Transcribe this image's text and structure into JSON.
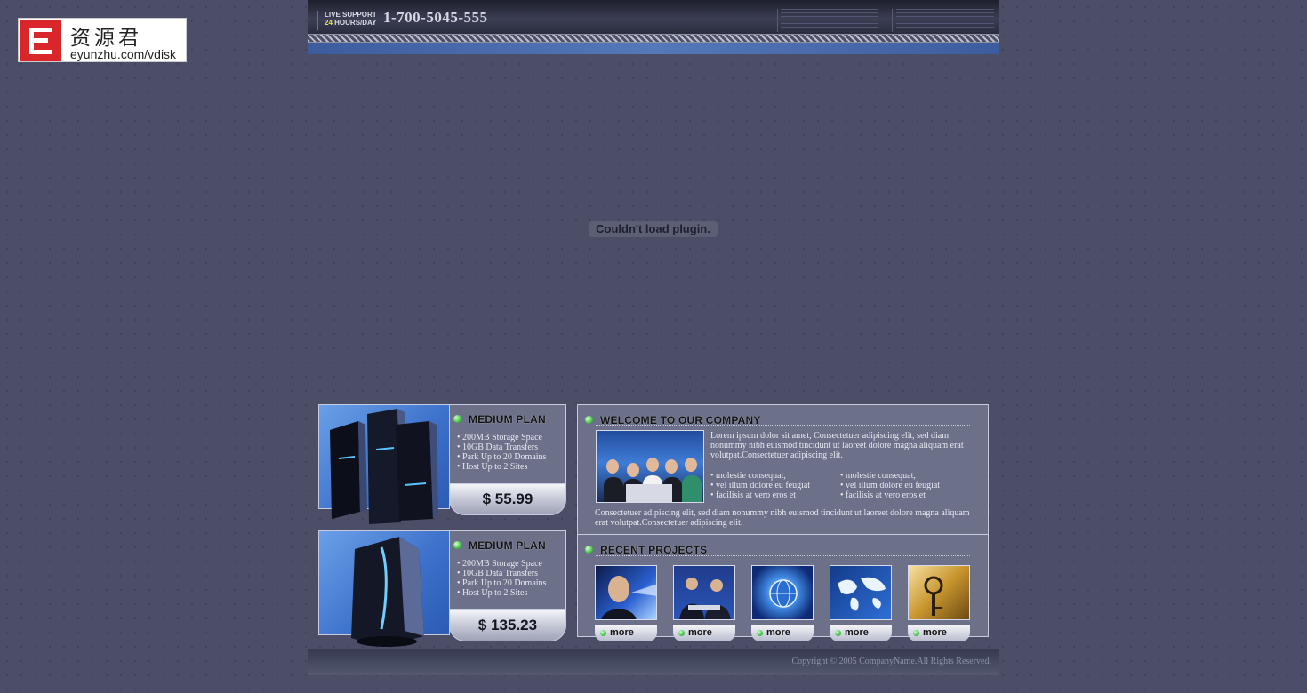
{
  "watermark": {
    "brand_cn": "资源君",
    "url": "eyunzhu.com/vdisk"
  },
  "header": {
    "live_support_line1": "LIVE SUPPORT",
    "live_support_24": "24",
    "live_support_line2": "HOURS/DAY",
    "phone": "1-700-5045-555"
  },
  "plugin": {
    "message": "Couldn't load plugin."
  },
  "plans": [
    {
      "title": "MEDIUM PLAN",
      "features": [
        "• 200MB Storage Space",
        "• 10GB Data Transfers",
        "• Park Up to 20 Domains",
        "• Host Up to 2 Sites"
      ],
      "price": "$ 55.99",
      "image": "server-rack"
    },
    {
      "title": "MEDIUM PLAN",
      "features": [
        "• 200MB Storage Space",
        "• 10GB Data Transfers",
        "• Park Up to 20 Domains",
        "• Host Up to 2 Sites"
      ],
      "price": "$ 135.23",
      "image": "server-tower"
    }
  ],
  "welcome": {
    "title": "WELCOME TO OUR COMPANY",
    "intro": "Lorem ipsum dolor sit amet, Consectetuer adipiscing elit, sed diam nonummy nibh euismod tincidunt ut laoreet dolore magna aliquam erat volutpat.Consectetuer adipiscing elit.",
    "bullets_left": [
      "• molestie consequat,",
      "• vel illum dolore eu feugiat",
      "• facilisis at vero eros et"
    ],
    "bullets_right": [
      "• molestie consequat,",
      "• vel illum dolore eu feugiat",
      "• facilisis at vero eros et"
    ],
    "outro": "Consectetuer adipiscing elit, sed diam nonummy nibh euismod tincidunt ut laoreet dolore magna aliquam erat volutpat.Consectetuer adipiscing elit."
  },
  "projects": {
    "title": "RECENT PROJECTS",
    "more_label": "more",
    "items": [
      "businessman",
      "business-meeting",
      "globe",
      "world-map",
      "golden-key"
    ]
  },
  "footer": {
    "copyright": "Copyright © 2005 CompanyName.All Rights Reserved."
  },
  "colors": {
    "page_bg": "#4b4e66",
    "panel_bg": "#6c7189",
    "accent_blue": "#3b6fc9"
  }
}
